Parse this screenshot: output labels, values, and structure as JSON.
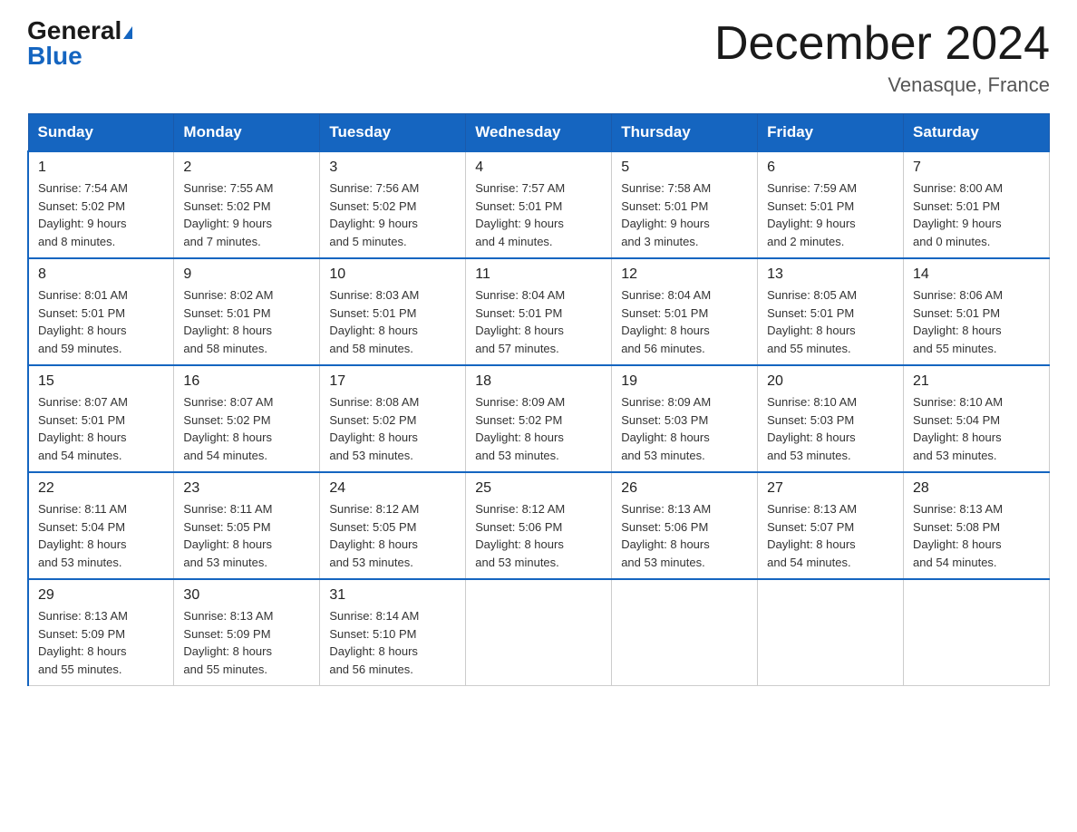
{
  "header": {
    "logo_general": "General",
    "logo_blue": "Blue",
    "month_title": "December 2024",
    "location": "Venasque, France"
  },
  "days_of_week": [
    "Sunday",
    "Monday",
    "Tuesday",
    "Wednesday",
    "Thursday",
    "Friday",
    "Saturday"
  ],
  "weeks": [
    [
      {
        "day": "1",
        "sunrise": "7:54 AM",
        "sunset": "5:02 PM",
        "daylight": "9 hours and 8 minutes."
      },
      {
        "day": "2",
        "sunrise": "7:55 AM",
        "sunset": "5:02 PM",
        "daylight": "9 hours and 7 minutes."
      },
      {
        "day": "3",
        "sunrise": "7:56 AM",
        "sunset": "5:02 PM",
        "daylight": "9 hours and 5 minutes."
      },
      {
        "day": "4",
        "sunrise": "7:57 AM",
        "sunset": "5:01 PM",
        "daylight": "9 hours and 4 minutes."
      },
      {
        "day": "5",
        "sunrise": "7:58 AM",
        "sunset": "5:01 PM",
        "daylight": "9 hours and 3 minutes."
      },
      {
        "day": "6",
        "sunrise": "7:59 AM",
        "sunset": "5:01 PM",
        "daylight": "9 hours and 2 minutes."
      },
      {
        "day": "7",
        "sunrise": "8:00 AM",
        "sunset": "5:01 PM",
        "daylight": "9 hours and 0 minutes."
      }
    ],
    [
      {
        "day": "8",
        "sunrise": "8:01 AM",
        "sunset": "5:01 PM",
        "daylight": "8 hours and 59 minutes."
      },
      {
        "day": "9",
        "sunrise": "8:02 AM",
        "sunset": "5:01 PM",
        "daylight": "8 hours and 58 minutes."
      },
      {
        "day": "10",
        "sunrise": "8:03 AM",
        "sunset": "5:01 PM",
        "daylight": "8 hours and 58 minutes."
      },
      {
        "day": "11",
        "sunrise": "8:04 AM",
        "sunset": "5:01 PM",
        "daylight": "8 hours and 57 minutes."
      },
      {
        "day": "12",
        "sunrise": "8:04 AM",
        "sunset": "5:01 PM",
        "daylight": "8 hours and 56 minutes."
      },
      {
        "day": "13",
        "sunrise": "8:05 AM",
        "sunset": "5:01 PM",
        "daylight": "8 hours and 55 minutes."
      },
      {
        "day": "14",
        "sunrise": "8:06 AM",
        "sunset": "5:01 PM",
        "daylight": "8 hours and 55 minutes."
      }
    ],
    [
      {
        "day": "15",
        "sunrise": "8:07 AM",
        "sunset": "5:01 PM",
        "daylight": "8 hours and 54 minutes."
      },
      {
        "day": "16",
        "sunrise": "8:07 AM",
        "sunset": "5:02 PM",
        "daylight": "8 hours and 54 minutes."
      },
      {
        "day": "17",
        "sunrise": "8:08 AM",
        "sunset": "5:02 PM",
        "daylight": "8 hours and 53 minutes."
      },
      {
        "day": "18",
        "sunrise": "8:09 AM",
        "sunset": "5:02 PM",
        "daylight": "8 hours and 53 minutes."
      },
      {
        "day": "19",
        "sunrise": "8:09 AM",
        "sunset": "5:03 PM",
        "daylight": "8 hours and 53 minutes."
      },
      {
        "day": "20",
        "sunrise": "8:10 AM",
        "sunset": "5:03 PM",
        "daylight": "8 hours and 53 minutes."
      },
      {
        "day": "21",
        "sunrise": "8:10 AM",
        "sunset": "5:04 PM",
        "daylight": "8 hours and 53 minutes."
      }
    ],
    [
      {
        "day": "22",
        "sunrise": "8:11 AM",
        "sunset": "5:04 PM",
        "daylight": "8 hours and 53 minutes."
      },
      {
        "day": "23",
        "sunrise": "8:11 AM",
        "sunset": "5:05 PM",
        "daylight": "8 hours and 53 minutes."
      },
      {
        "day": "24",
        "sunrise": "8:12 AM",
        "sunset": "5:05 PM",
        "daylight": "8 hours and 53 minutes."
      },
      {
        "day": "25",
        "sunrise": "8:12 AM",
        "sunset": "5:06 PM",
        "daylight": "8 hours and 53 minutes."
      },
      {
        "day": "26",
        "sunrise": "8:13 AM",
        "sunset": "5:06 PM",
        "daylight": "8 hours and 53 minutes."
      },
      {
        "day": "27",
        "sunrise": "8:13 AM",
        "sunset": "5:07 PM",
        "daylight": "8 hours and 54 minutes."
      },
      {
        "day": "28",
        "sunrise": "8:13 AM",
        "sunset": "5:08 PM",
        "daylight": "8 hours and 54 minutes."
      }
    ],
    [
      {
        "day": "29",
        "sunrise": "8:13 AM",
        "sunset": "5:09 PM",
        "daylight": "8 hours and 55 minutes."
      },
      {
        "day": "30",
        "sunrise": "8:13 AM",
        "sunset": "5:09 PM",
        "daylight": "8 hours and 55 minutes."
      },
      {
        "day": "31",
        "sunrise": "8:14 AM",
        "sunset": "5:10 PM",
        "daylight": "8 hours and 56 minutes."
      },
      null,
      null,
      null,
      null
    ]
  ],
  "labels": {
    "sunrise": "Sunrise:",
    "sunset": "Sunset:",
    "daylight": "Daylight:"
  }
}
